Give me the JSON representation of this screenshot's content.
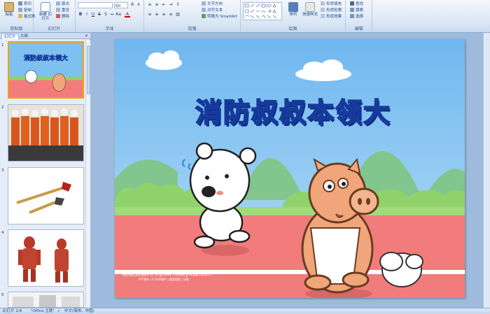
{
  "ribbon": {
    "clipboard": {
      "label": "剪贴板",
      "paste": "粘贴",
      "cut": "剪切",
      "copy": "复制",
      "format_painter": "格式刷"
    },
    "slides": {
      "label": "幻灯片",
      "new_slide": "新建\n幻灯片",
      "layout": "版式",
      "reset": "重设",
      "delete": "删除"
    },
    "font": {
      "label": "字体",
      "font_name": "",
      "font_size": "60"
    },
    "paragraph": {
      "label": "段落",
      "text_direction": "文字方向",
      "align_text": "对齐文本",
      "smartart": "转换为 SmartArt"
    },
    "drawing": {
      "label": "绘图",
      "arrange": "排列",
      "quick_styles": "快速样式",
      "shape_fill": "形状填充",
      "shape_outline": "形状轮廓",
      "shape_effects": "形状效果"
    },
    "editing": {
      "label": "编辑",
      "find": "查找",
      "replace": "替换",
      "select": "选择"
    }
  },
  "pane": {
    "tab_slides": "幻灯片",
    "tab_outline": "大纲",
    "close": "×",
    "thumbnails": [
      {
        "num": "1",
        "title": "消防叔叔本领大"
      },
      {
        "num": "2",
        "title": ""
      },
      {
        "num": "3",
        "title": ""
      },
      {
        "num": "4",
        "title": ""
      },
      {
        "num": "5",
        "title": ""
      }
    ]
  },
  "slide": {
    "title": "消防叔叔本领大",
    "watermark": "幼教资源网 ziyuan.baby611.com",
    "watermark_sub": "PPT课件 | FLASH课件 | 教案搜索 | 试卷"
  },
  "status": {
    "slide_counter": "幻灯片 1/9",
    "theme": "\"Office 主题\"",
    "language": "中文(简体，中国)"
  },
  "colors": {
    "accent": "#f2a200",
    "sky": "#7ec1f0",
    "track": "#f27c7c",
    "grass": "#8fd36a"
  }
}
